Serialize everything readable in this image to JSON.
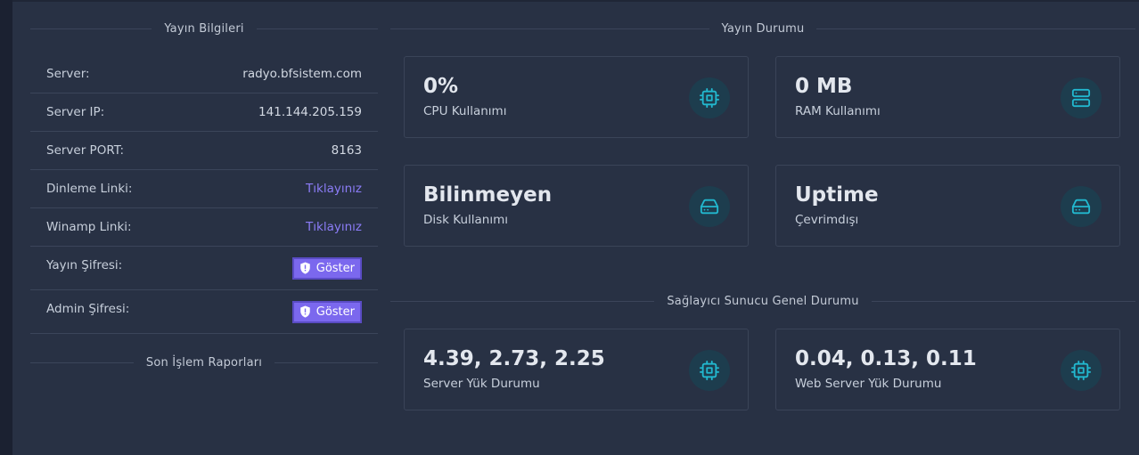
{
  "left_panel": {
    "title": "Yayın Bilgileri",
    "rows": [
      {
        "label": "Server:",
        "value": "radyo.bfsistem.com"
      },
      {
        "label": "Server IP:",
        "value": "141.144.205.159"
      },
      {
        "label": "Server PORT:",
        "value": "8163"
      },
      {
        "label": "Dinleme Linki:",
        "value": "Tıklayınız"
      },
      {
        "label": "Winamp Linki:",
        "value": "Tıklayınız"
      },
      {
        "label": "Yayın Şifresi:",
        "value": "Göster"
      },
      {
        "label": "Admin Şifresi:",
        "value": "Göster"
      }
    ],
    "reports_title": "Son İşlem Raporları"
  },
  "status": {
    "title": "Yayın Durumu",
    "cards": [
      {
        "value": "0%",
        "label": "CPU Kullanımı",
        "icon": "cpu-icon"
      },
      {
        "value": "0 MB",
        "label": "RAM Kullanımı",
        "icon": "server-icon"
      },
      {
        "value": "Bilinmeyen",
        "label": "Disk Kullanımı",
        "icon": "hard-drive-icon"
      },
      {
        "value": "Uptime",
        "label": "Çevrimdışı",
        "icon": "hard-drive-icon"
      }
    ]
  },
  "provider": {
    "title": "Sağlayıcı Sunucu Genel Durumu",
    "cards": [
      {
        "value": "4.39, 2.73, 2.25",
        "label": "Server Yük Durumu",
        "icon": "cpu-icon"
      },
      {
        "value": "0.04, 0.13, 0.11",
        "label": "Web Server Yük Durumu",
        "icon": "cpu-icon"
      }
    ]
  },
  "colors": {
    "background": "#283144",
    "accent": "#7b68ee",
    "link": "#8b7cf6",
    "icon": "#22b8cf"
  }
}
